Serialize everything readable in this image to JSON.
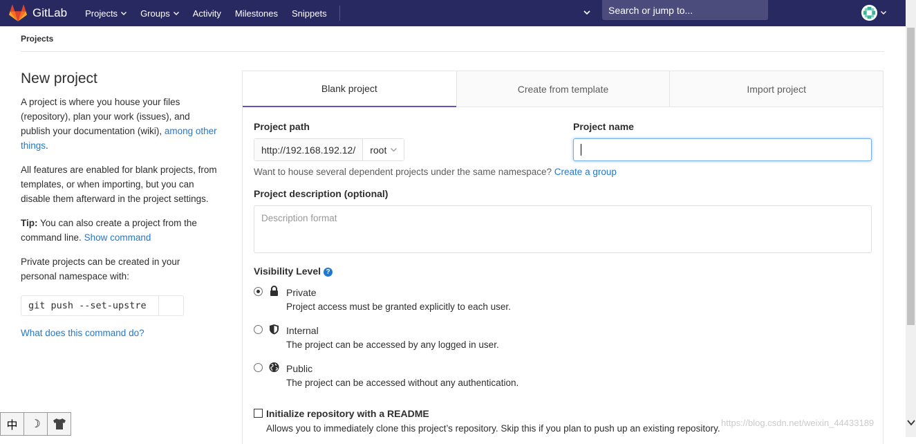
{
  "navbar": {
    "brand": "GitLab",
    "links": [
      {
        "label": "Projects",
        "dropdown": true
      },
      {
        "label": "Groups",
        "dropdown": true
      },
      {
        "label": "Activity",
        "dropdown": false
      },
      {
        "label": "Milestones",
        "dropdown": false
      },
      {
        "label": "Snippets",
        "dropdown": false
      }
    ],
    "search_text": "Search or jump to...",
    "colors": {
      "background": "#292961",
      "search": "#4b4b7c",
      "logo": "#e24329"
    }
  },
  "breadcrumb": "Projects",
  "sidebar": {
    "title": "New project",
    "para1_text": "A project is where you house your files (repository), plan your work (issues), and publish your documentation (wiki),",
    "para1_link": "among other things",
    "para1_end": ".",
    "para2": "All features are enabled for blank projects, from templates, or when importing, but you can disable them afterward in the project settings.",
    "tip_label": "Tip:",
    "tip_text": "You can also create a project from the command line.",
    "tip_link": "Show command",
    "para4": "Private projects can be created in your personal namespace with:",
    "command": "git push --set-upstre",
    "help_link": "What does this command do?"
  },
  "tabs": [
    {
      "label": "Blank project",
      "active": true
    },
    {
      "label": "Create from template",
      "active": false
    },
    {
      "label": "Import project",
      "active": false
    }
  ],
  "form": {
    "path_label": "Project path",
    "path_prefix": "http://192.168.192.12/",
    "namespace": "root",
    "name_label": "Project name",
    "name_value": "",
    "namespace_help": "Want to house several dependent projects under the same namespace?",
    "namespace_help_link": "Create a group",
    "description_label": "Project description (optional)",
    "description_placeholder": "Description format",
    "visibility_label": "Visibility Level",
    "visibility_options": [
      {
        "title": "Private",
        "desc": "Project access must be granted explicitly to each user.",
        "icon": "lock-icon",
        "checked": true
      },
      {
        "title": "Internal",
        "desc": "The project can be accessed by any logged in user.",
        "icon": "shield-icon",
        "checked": false
      },
      {
        "title": "Public",
        "desc": "The project can be accessed without any authentication.",
        "icon": "globe-icon",
        "checked": false
      }
    ],
    "readme_label": "Initialize repository with a README",
    "readme_desc": "Allows you to immediately clone this project’s repository. Skip this if you plan to push up an existing repository.",
    "readme_checked": false
  },
  "watermark": "https://blog.csdn.net/weixin_44433189",
  "ime": {
    "lang": "中",
    "moon": "☽",
    "shirt": "👕"
  }
}
